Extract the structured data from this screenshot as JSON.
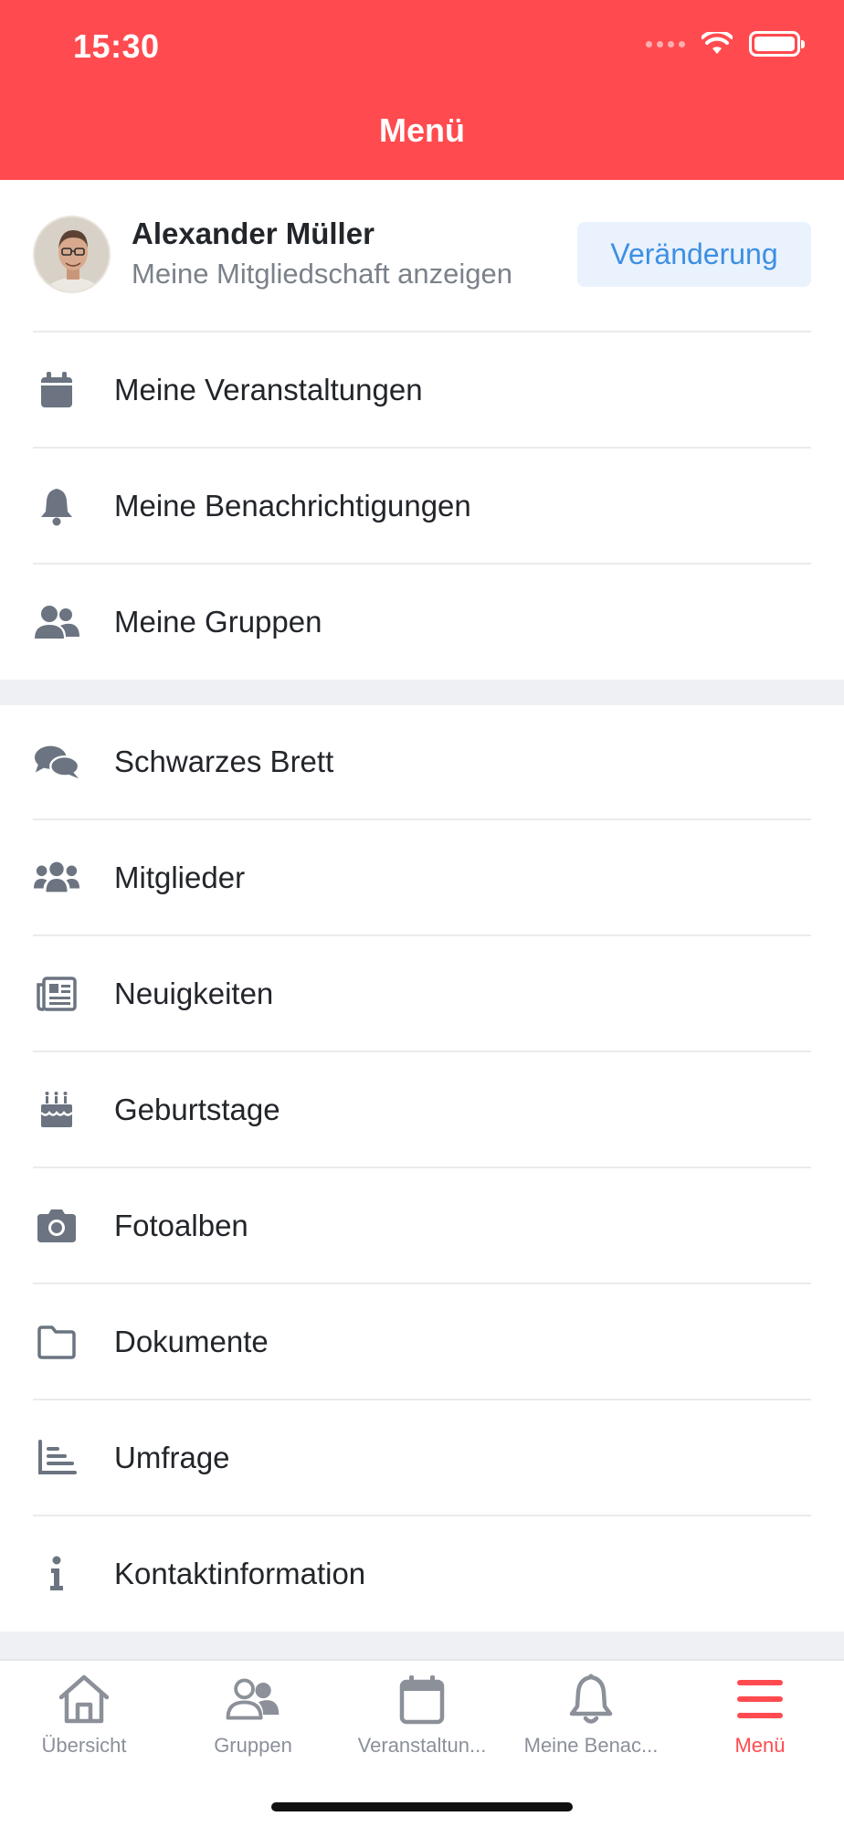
{
  "status": {
    "time": "15:30"
  },
  "header": {
    "title": "Menü"
  },
  "profile": {
    "name": "Alexander Müller",
    "subtitle": "Meine Mitgliedschaft anzeigen",
    "change_label": "Veränderung"
  },
  "menu_primary": [
    {
      "label": "Meine Veranstaltungen",
      "icon": "calendar-icon"
    },
    {
      "label": "Meine Benachrichtigungen",
      "icon": "bell-icon"
    },
    {
      "label": "Meine Gruppen",
      "icon": "users-icon"
    }
  ],
  "menu_secondary": [
    {
      "label": "Schwarzes Brett",
      "icon": "comments-icon"
    },
    {
      "label": "Mitglieder",
      "icon": "members-icon"
    },
    {
      "label": "Neuigkeiten",
      "icon": "newspaper-icon"
    },
    {
      "label": "Geburtstage",
      "icon": "birthday-cake-icon"
    },
    {
      "label": "Fotoalben",
      "icon": "camera-icon"
    },
    {
      "label": "Dokumente",
      "icon": "folder-icon"
    },
    {
      "label": "Umfrage",
      "icon": "poll-chart-icon"
    },
    {
      "label": "Kontaktinformation",
      "icon": "info-icon"
    }
  ],
  "tabs": [
    {
      "label": "Übersicht",
      "icon": "home-icon",
      "active": false
    },
    {
      "label": "Gruppen",
      "icon": "group-icon",
      "active": false
    },
    {
      "label": "Veranstaltun...",
      "icon": "calendar-icon",
      "active": false
    },
    {
      "label": "Meine Benac...",
      "icon": "bell-icon",
      "active": false
    },
    {
      "label": "Menü",
      "icon": "menu-icon",
      "active": true
    }
  ],
  "colors": {
    "accent": "#ff4b4f",
    "link": "#3d8fe3",
    "icon": "#6b7480"
  }
}
